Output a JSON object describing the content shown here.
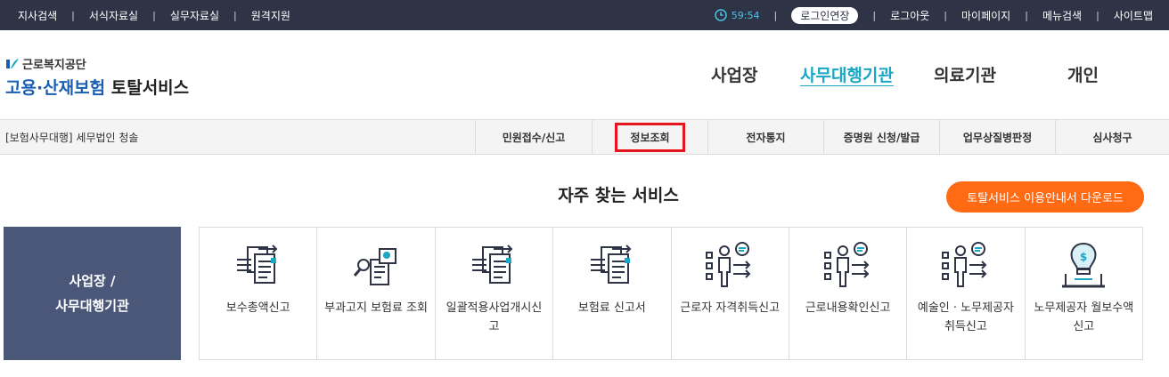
{
  "topbar": {
    "left_links": [
      "지사검색",
      "서식자료실",
      "실무자료실",
      "원격지원"
    ],
    "timer": "59:54",
    "timer_icon": "clock-icon",
    "extend_label": "로그인연장",
    "right_links": [
      "로그아웃",
      "마이페이지",
      "메뉴검색",
      "사이트맵"
    ],
    "separator": "|"
  },
  "logo": {
    "org": "근로복지공단",
    "title_main": "고용·산재보험",
    "title_sub": "토탈서비스"
  },
  "main_nav": {
    "items": [
      "사업장",
      "사무대행기관",
      "의료기관",
      "개인"
    ],
    "active": "사무대행기관"
  },
  "sub_nav": {
    "agency": "[보험사무대행] 세무법인 청솔",
    "items": [
      "민원접수/신고",
      "정보조회",
      "전자통지",
      "증명원 신청/발급",
      "업무상질병판정",
      "심사청구"
    ],
    "highlighted": "정보조회"
  },
  "frequent": {
    "title": "자주 찾는 서비스",
    "guide_button": "토탈서비스 이용안내서 다운로드",
    "side_box": [
      "사업장 /",
      "사무대행기관"
    ],
    "cards": [
      {
        "label": "보수총액신고",
        "icon": "document-arrows-icon"
      },
      {
        "label": "부과고지 보험료 조회",
        "icon": "search-document-icon"
      },
      {
        "label": "일괄적용사업개시신고",
        "icon": "document-arrows-icon"
      },
      {
        "label": "보험료 신고서",
        "icon": "document-arrows-icon"
      },
      {
        "label": "근로자 자격취득신고",
        "icon": "person-checklist-icon"
      },
      {
        "label": "근로내용확인신고",
        "icon": "person-checklist-icon"
      },
      {
        "label": "예술인 · 노무제공자 취득신고",
        "icon": "person-checklist-icon"
      },
      {
        "label": "노무제공자 월보수액 신고",
        "icon": "money-bulb-icon"
      }
    ]
  },
  "colors": {
    "topbar_bg": "#2e3446",
    "accent": "#1aa6c4",
    "highlight_border": "#e8141c",
    "guide_button_bg": "#ff6a13",
    "side_box_bg": "#4a5779",
    "logo_blue": "#1b5fb3"
  }
}
